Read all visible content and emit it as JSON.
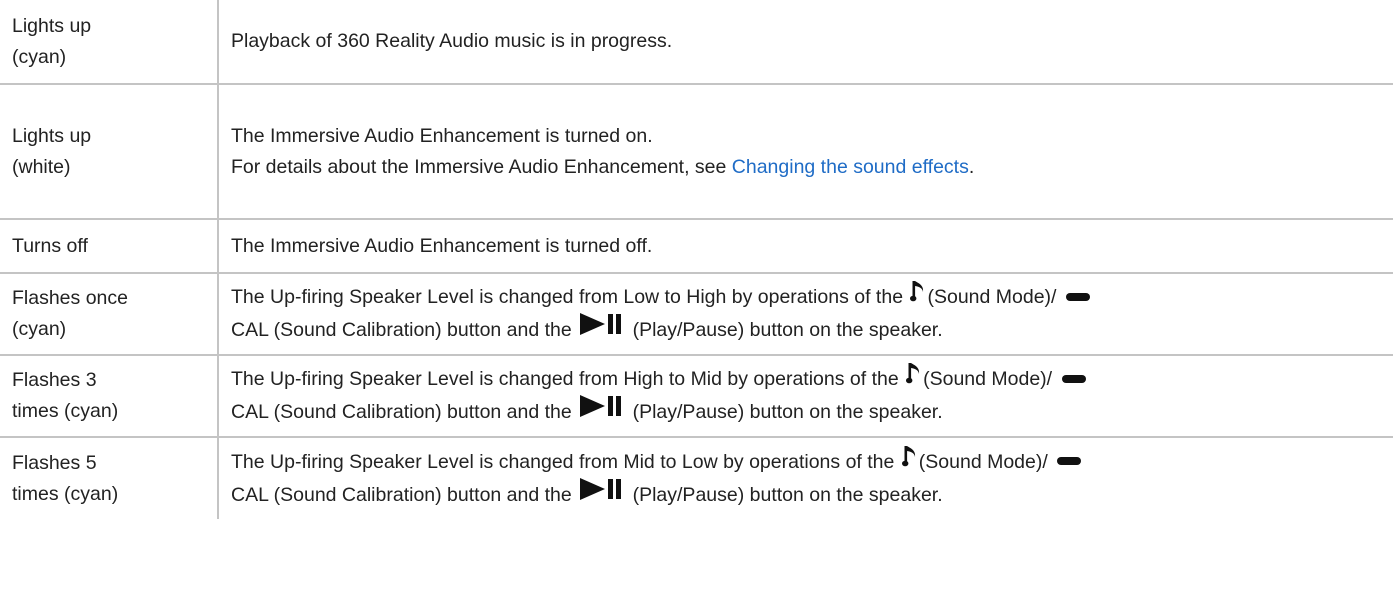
{
  "rows": [
    {
      "indicator": [
        "Lights up",
        "(cyan)"
      ],
      "description": "Playback of 360 Reality Audio music is in progress."
    },
    {
      "indicator": [
        "Lights up",
        "(white)"
      ],
      "line1": "The Immersive Audio Enhancement is turned on.",
      "line2_prefix": "For details about the Immersive Audio Enhancement, see ",
      "link": "Changing the sound effects",
      "line2_suffix": "."
    },
    {
      "indicator": [
        "Turns off"
      ],
      "description": "The Immersive Audio Enhancement is turned off."
    },
    {
      "indicator": [
        "Flashes once",
        "(cyan)"
      ],
      "desc_prefix": "The Up-firing Speaker Level is changed from Low to High by operations of the ",
      "desc_sound_mode": "(Sound Mode)/ ",
      "desc_cal": "CAL (Sound Calibration) button and the ",
      "desc_play": " (Play/Pause) button on the speaker."
    },
    {
      "indicator": [
        "Flashes 3",
        "times (cyan)"
      ],
      "desc_prefix": "The Up-firing Speaker Level is changed from High to Mid by operations of the ",
      "desc_sound_mode": "(Sound Mode)/ ",
      "desc_cal": "CAL (Sound Calibration) button and the ",
      "desc_play": " (Play/Pause) button on the speaker."
    },
    {
      "indicator": [
        "Flashes 5",
        "times (cyan)"
      ],
      "desc_prefix": "The Up-firing Speaker Level is changed from Mid to Low by operations of the ",
      "desc_sound_mode": "(Sound Mode)/ ",
      "desc_cal": "CAL (Sound Calibration) button and the ",
      "desc_play": " (Play/Pause) button on the speaker."
    }
  ],
  "icons": {
    "sound_mode": "music-note-icon",
    "calibration": "bar-icon",
    "play_pause": "play-pause-icon"
  },
  "colors": {
    "link": "#1f6cc6",
    "text": "#222222",
    "border": "#c4c4c4"
  }
}
